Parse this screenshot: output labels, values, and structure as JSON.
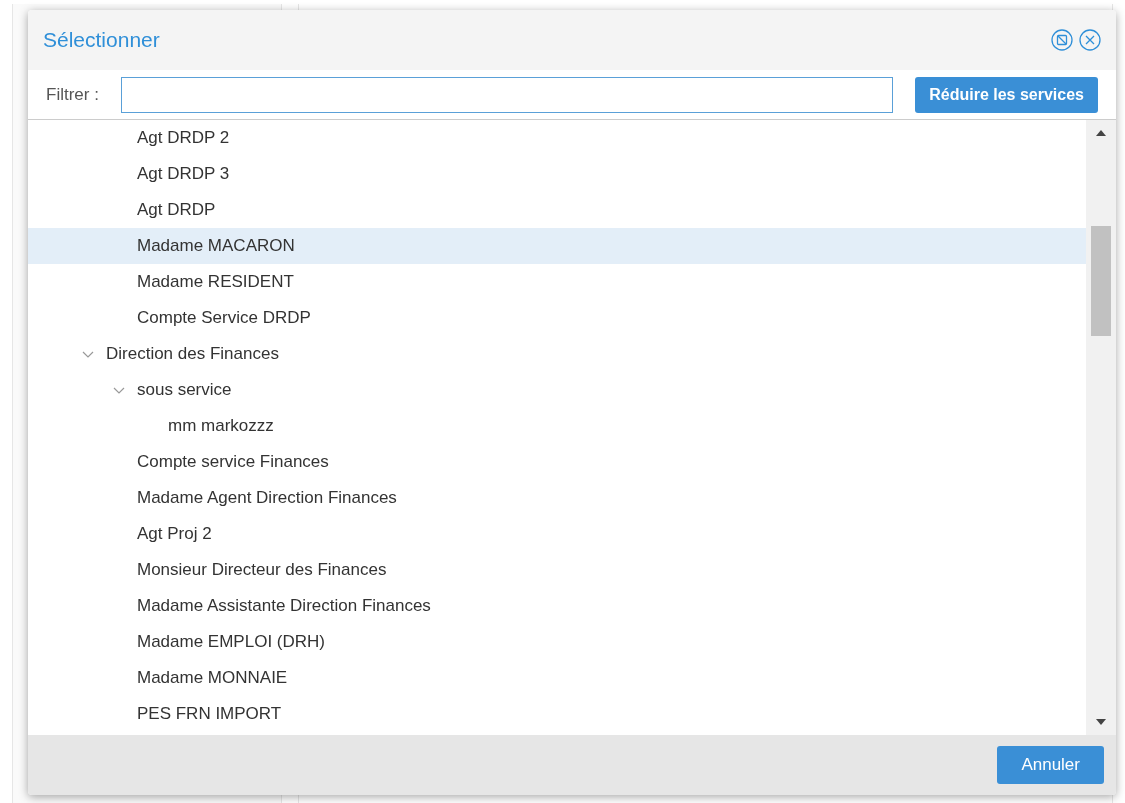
{
  "dialog": {
    "title": "Sélectionner",
    "filter": {
      "label": "Filtrer :"
    },
    "reduce_button": "Réduire les services",
    "tree": [
      {
        "children": [
          {
            "label": "Agt DRDP 2",
            "selected": false
          },
          {
            "label": "Agt DRDP 3",
            "selected": false
          },
          {
            "label": "Agt DRDP",
            "selected": false
          },
          {
            "label": "Madame MACARON",
            "selected": true
          },
          {
            "label": "Madame RESIDENT",
            "selected": false
          },
          {
            "label": "Compte Service DRDP",
            "selected": false
          }
        ]
      },
      {
        "label": "Direction des Finances",
        "selected": false,
        "expanded": true,
        "children": [
          {
            "label": "sous service",
            "selected": false,
            "expanded": true,
            "children": [
              {
                "label": "mm markozzz",
                "selected": false
              }
            ]
          },
          {
            "label": "Compte service Finances",
            "selected": false
          },
          {
            "label": "Madame Agent Direction Finances",
            "selected": false
          },
          {
            "label": "Agt Proj 2",
            "selected": false
          },
          {
            "label": "Monsieur Directeur des Finances",
            "selected": false
          },
          {
            "label": "Madame Assistante Direction Finances",
            "selected": false
          },
          {
            "label": "Madame EMPLOI (DRH)",
            "selected": false
          },
          {
            "label": "Madame MONNAIE",
            "selected": false
          },
          {
            "label": "PES FRN IMPORT",
            "selected": false
          }
        ]
      }
    ],
    "cancel_button": "Annuler"
  }
}
